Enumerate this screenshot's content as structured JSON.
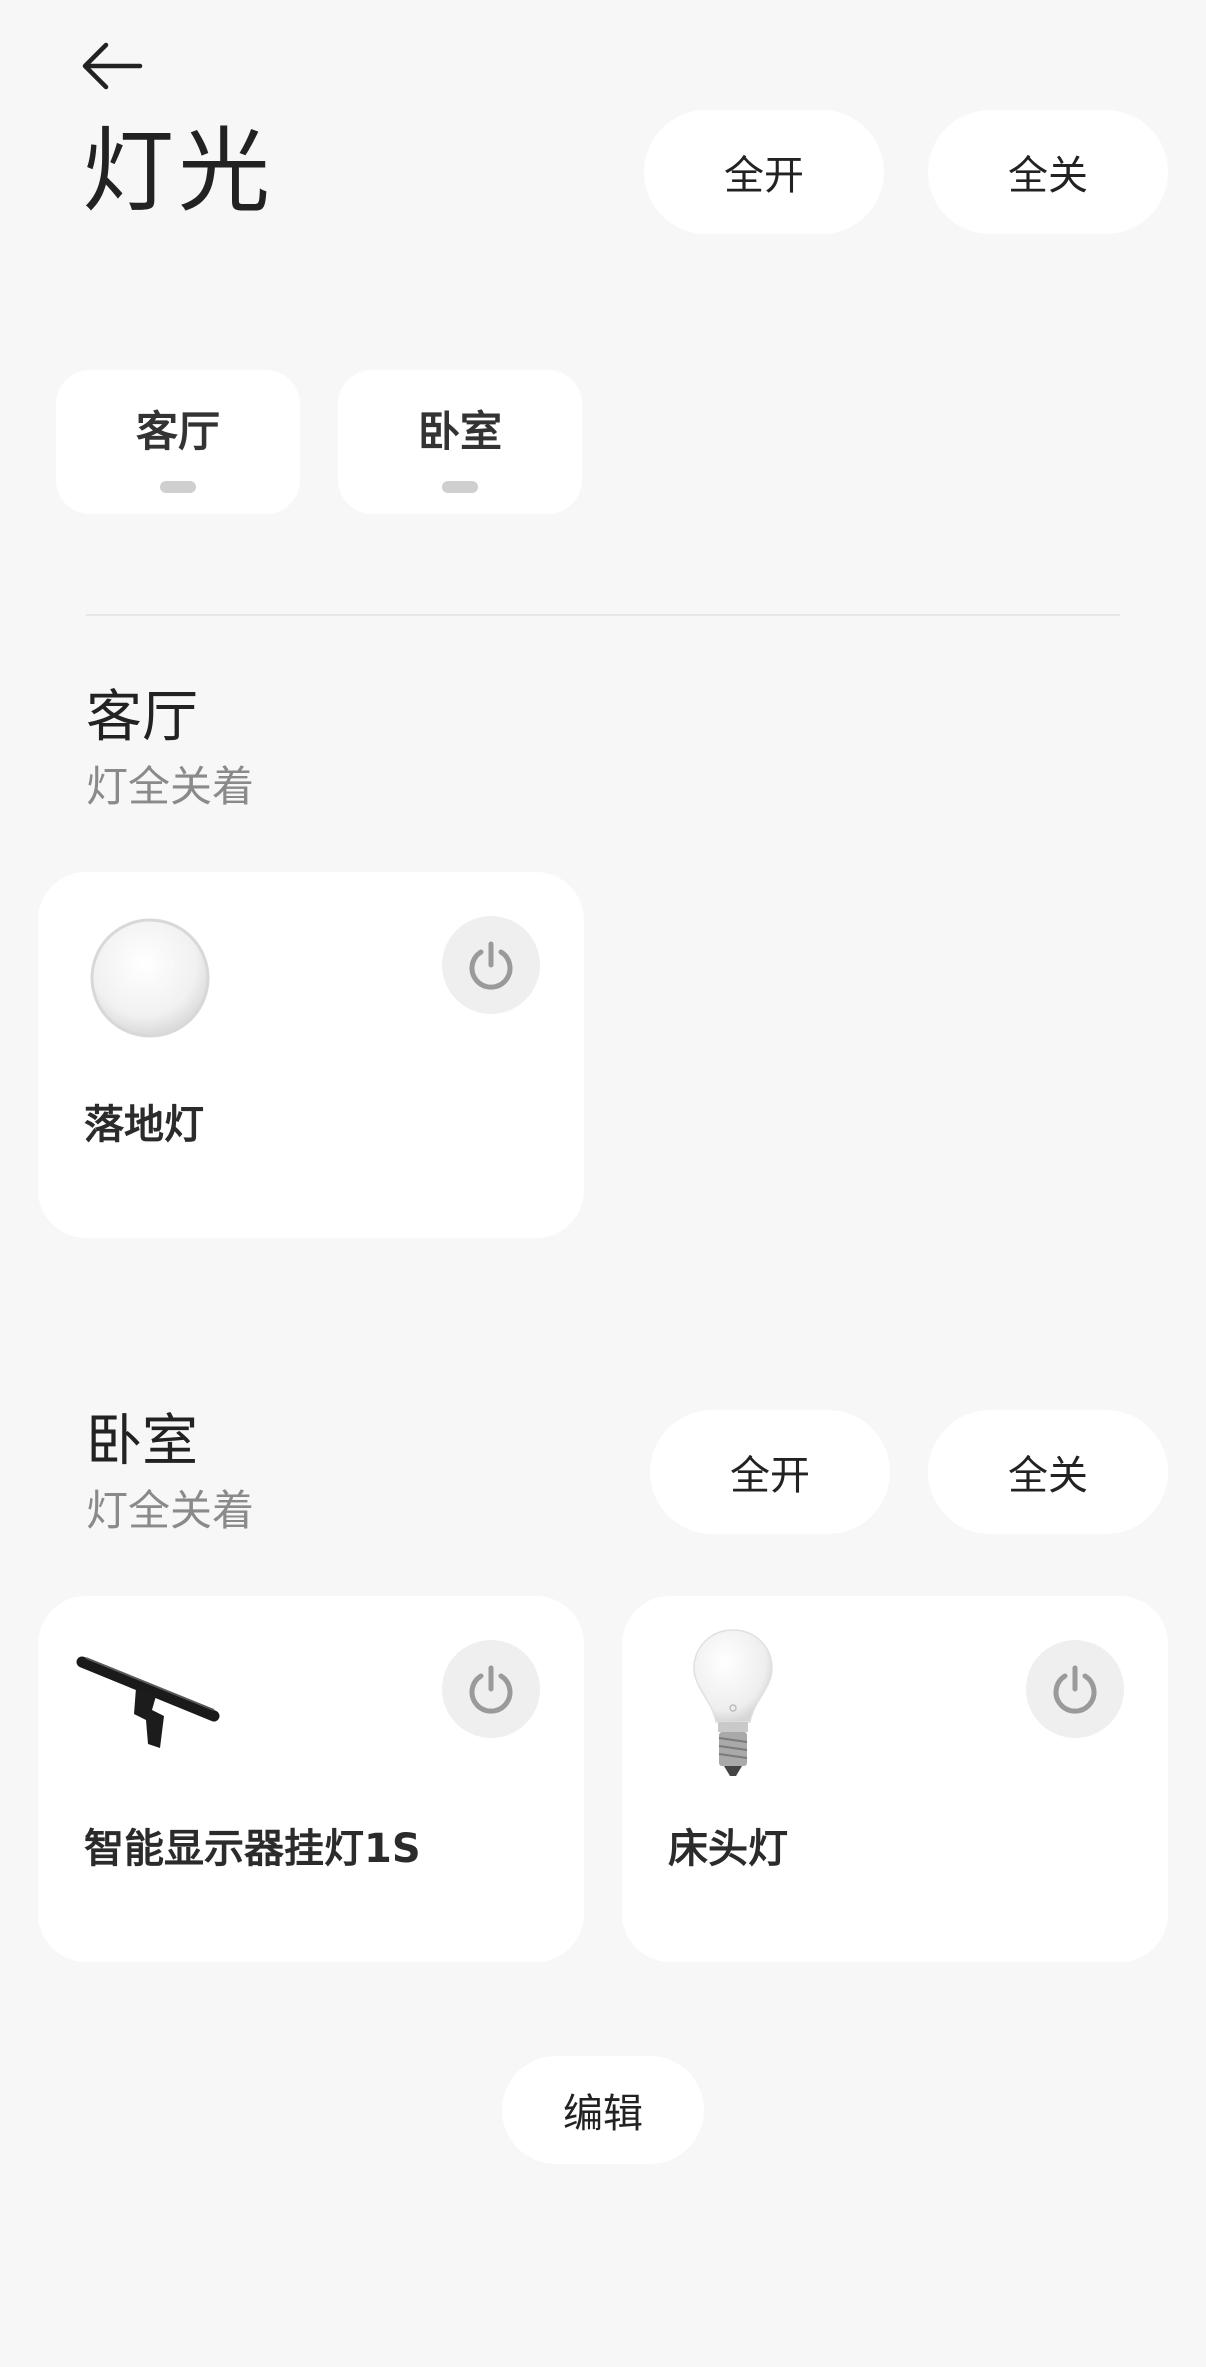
{
  "header": {
    "title": "灯光",
    "all_on_label": "全开",
    "all_off_label": "全关"
  },
  "room_tabs": [
    {
      "label": "客厅"
    },
    {
      "label": "卧室"
    }
  ],
  "sections": [
    {
      "title": "客厅",
      "status": "灯全关着",
      "devices": [
        {
          "name": "落地灯",
          "icon": "floor-lamp-icon"
        }
      ]
    },
    {
      "title": "卧室",
      "status": "灯全关着",
      "all_on_label": "全开",
      "all_off_label": "全关",
      "devices": [
        {
          "name": "智能显示器挂灯1S",
          "icon": "monitor-light-bar-icon"
        },
        {
          "name": "床头灯",
          "icon": "light-bulb-icon"
        }
      ]
    }
  ],
  "footer": {
    "edit_label": "编辑"
  },
  "colors": {
    "background": "#f7f7f7",
    "card": "#ffffff",
    "power_button_bg": "#efefef",
    "power_icon": "#9a9a9a",
    "secondary_text": "#8a8a8a"
  }
}
